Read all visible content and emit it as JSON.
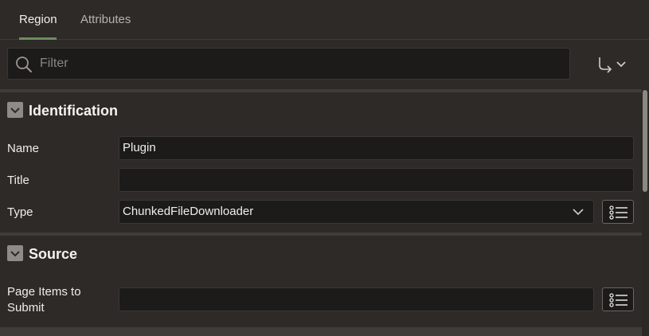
{
  "tabs": [
    {
      "label": "Region",
      "active": true
    },
    {
      "label": "Attributes",
      "active": false
    }
  ],
  "filter": {
    "placeholder": "Filter",
    "value": ""
  },
  "icons": {
    "filter": "search-icon",
    "goto": "goto-group-icon",
    "expand": "chevron-down-icon",
    "list": "list-picker-icon"
  },
  "sections": {
    "identification": {
      "title": "Identification",
      "name_label": "Name",
      "name_value": "Plugin",
      "title_label": "Title",
      "title_value": "",
      "type_label": "Type",
      "type_value": "ChunkedFileDownloader"
    },
    "source": {
      "title": "Source",
      "page_items_label_line1": "Page Items to",
      "page_items_label_line2": "Submit",
      "page_items_value": ""
    }
  },
  "colors": {
    "background": "#2d2a27",
    "field_background": "#1c1b19",
    "active_tab_underline": "#6f8c5e",
    "toggle": "#8f8b87"
  }
}
